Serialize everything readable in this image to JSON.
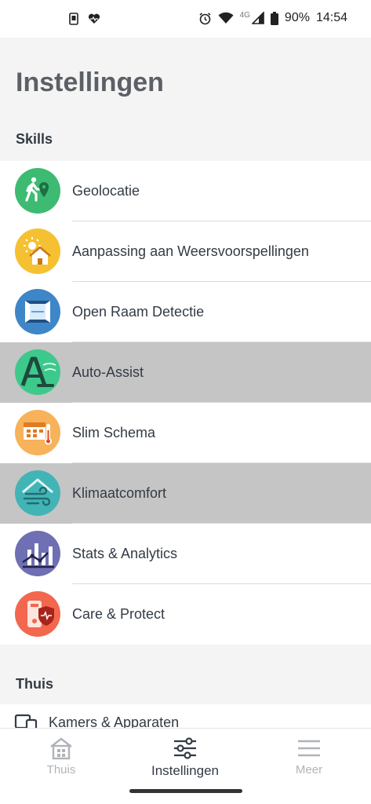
{
  "status_bar": {
    "network": "4G",
    "battery": "90%",
    "time": "14:54"
  },
  "page": {
    "title": "Instellingen"
  },
  "sections": {
    "skills": {
      "header": "Skills",
      "items": [
        {
          "label": "Geolocatie",
          "icon": "geolocation-icon",
          "color": "#3dbb72",
          "highlighted": false
        },
        {
          "label": "Aanpassing aan Weersvoorspellingen",
          "icon": "weather-house-icon",
          "color": "#f5c132",
          "highlighted": false
        },
        {
          "label": "Open Raam Detectie",
          "icon": "open-window-icon",
          "color": "#3e86c8",
          "highlighted": false
        },
        {
          "label": "Auto-Assist",
          "icon": "auto-assist-icon",
          "color": "#3ec98c",
          "highlighted": true
        },
        {
          "label": "Slim Schema",
          "icon": "smart-schedule-icon",
          "color": "#f7b25a",
          "highlighted": false
        },
        {
          "label": "Klimaatcomfort",
          "icon": "climate-comfort-icon",
          "color": "#43b4b6",
          "highlighted": true
        },
        {
          "label": "Stats & Analytics",
          "icon": "stats-icon",
          "color": "#6f6fb3",
          "highlighted": false
        },
        {
          "label": "Care & Protect",
          "icon": "care-protect-icon",
          "color": "#f2674e",
          "highlighted": false
        }
      ]
    },
    "thuis": {
      "header": "Thuis",
      "items": [
        {
          "label": "Kamers & Apparaten",
          "icon": "rooms-devices-icon"
        }
      ]
    }
  },
  "bottom_nav": {
    "items": [
      {
        "label": "Thuis",
        "icon": "home-icon",
        "active": false
      },
      {
        "label": "Instellingen",
        "icon": "sliders-icon",
        "active": true
      },
      {
        "label": "Meer",
        "icon": "menu-icon",
        "active": false
      }
    ]
  },
  "colors": {
    "text_primary": "#333b45",
    "title": "#5b5f66",
    "highlight": "#c5c5c5",
    "inactive_nav": "#b0b3b8"
  }
}
